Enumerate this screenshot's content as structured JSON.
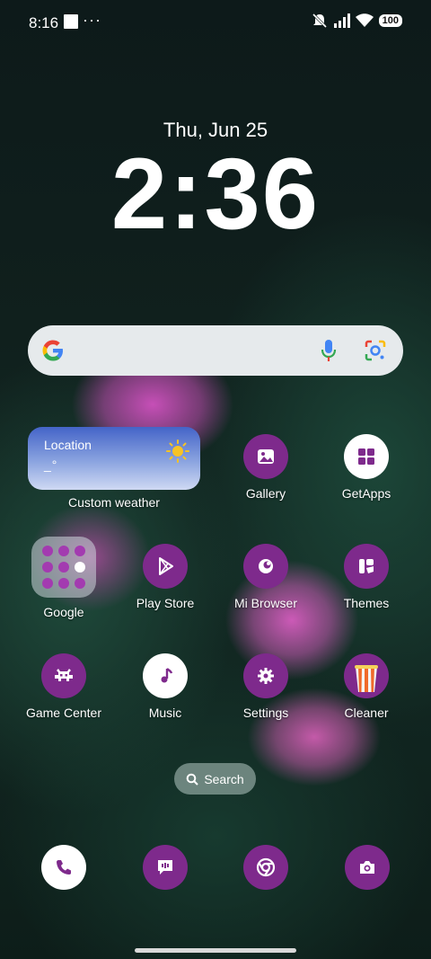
{
  "status_bar": {
    "time": "8:16",
    "more": "···",
    "battery": "100",
    "icons": [
      "notification-square-icon",
      "vibrate-off-icon",
      "signal-icon",
      "wifi-icon",
      "battery-icon"
    ]
  },
  "lock_clock": {
    "date": "Thu, Jun 25",
    "time": "2:36"
  },
  "google_search": {
    "icons": [
      "google-logo-icon",
      "microphone-icon",
      "lens-icon"
    ]
  },
  "weather_widget": {
    "location": "Location",
    "temperature": "_°",
    "label": "Custom weather",
    "icon": "sun-icon"
  },
  "apps": {
    "gallery": "Gallery",
    "getapps": "GetApps",
    "google": "Google",
    "play_store": "Play Store",
    "mi_browser": "Mi Browser",
    "themes": "Themes",
    "game_center": "Game Center",
    "music": "Music",
    "settings": "Settings",
    "cleaner": "Cleaner"
  },
  "app_search": {
    "label": "Search"
  },
  "dock": {
    "icons": [
      "phone-icon",
      "messaging-icon",
      "chrome-icon",
      "camera-icon"
    ]
  },
  "colors": {
    "accent_purple": "#7e2a8c",
    "search_bar": "#e6eaec",
    "weather_top": "#4464c8"
  }
}
